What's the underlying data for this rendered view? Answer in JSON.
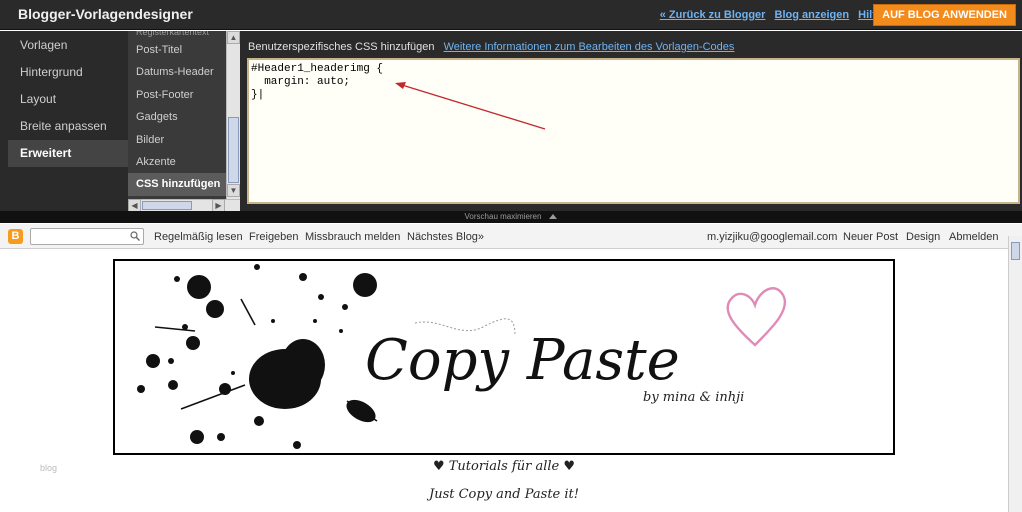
{
  "app": {
    "title": "Blogger-Vorlagendesigner"
  },
  "top_links": [
    {
      "label": "« Zurück zu Blogger"
    },
    {
      "label": "Blog anzeigen"
    },
    {
      "label": "Hilfe"
    }
  ],
  "apply_button": "AUF BLOG ANWENDEN",
  "left_nav": [
    {
      "label": "Vorlagen",
      "active": false
    },
    {
      "label": "Hintergrund",
      "active": false
    },
    {
      "label": "Layout",
      "active": false
    },
    {
      "label": "Breite anpassen",
      "active": false
    },
    {
      "label": "Erweitert",
      "active": true
    }
  ],
  "sub_nav": [
    {
      "label": "Registerkartentext",
      "active": false
    },
    {
      "label": "Post-Titel",
      "active": false
    },
    {
      "label": "Datums-Header",
      "active": false
    },
    {
      "label": "Post-Footer",
      "active": false
    },
    {
      "label": "Gadgets",
      "active": false
    },
    {
      "label": "Bilder",
      "active": false
    },
    {
      "label": "Akzente",
      "active": false
    },
    {
      "label": "CSS hinzufügen",
      "active": true
    }
  ],
  "css_panel": {
    "header": "Benutzerspezifisches CSS hinzufügen",
    "link": "Weitere Informationen zum Bearbeiten des Vorlagen-Codes",
    "code": "#Header1_headerimg {\n  margin: auto;\n}|",
    "arrow_color": "#c0282d"
  },
  "preview_bar": {
    "label": "Vorschau maximieren"
  },
  "navbar": {
    "logo": "B",
    "links_left": [
      "Regelmäßig lesen",
      "Freigeben",
      "Missbrauch melden",
      "Nächstes Blog»"
    ],
    "email": "m.yizjiku@googlemail.com",
    "links_right": [
      "Neuer Post",
      "Design",
      "Abmelden"
    ]
  },
  "blog": {
    "header_image": {
      "title": "Copy Paste",
      "signature": "by mina & inhji"
    },
    "sidebar_label": "blog",
    "tagline1": "♥ Tutorials für alle ♥",
    "tagline2": "Just Copy and Paste it!"
  },
  "colors": {
    "topbar_bg": "#2a2a2a",
    "link": "#6fb3f2",
    "apply_button": "#f38b1c",
    "heart": "#e08bb7"
  }
}
